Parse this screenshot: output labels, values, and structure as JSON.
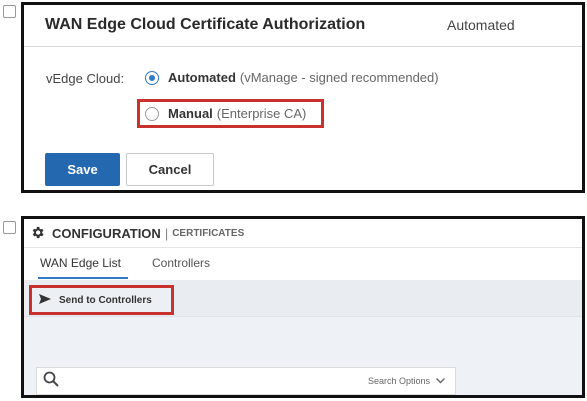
{
  "panel1": {
    "title": "WAN Edge Cloud Certificate Authorization",
    "status": "Automated",
    "field_label": "vEdge Cloud:",
    "option_automated": {
      "label": "Automated",
      "note": "(vManage - signed recommended)",
      "selected": true
    },
    "option_manual": {
      "label": "Manual",
      "note": "(Enterprise CA)",
      "selected": false
    },
    "save_label": "Save",
    "cancel_label": "Cancel"
  },
  "panel2": {
    "title": "CONFIGURATION",
    "separator": "|",
    "subtitle": "CERTIFICATES",
    "tabs": [
      {
        "label": "WAN Edge List",
        "active": true
      },
      {
        "label": "Controllers",
        "active": false
      }
    ],
    "send_label": "Send to Controllers",
    "search": {
      "value": "",
      "options_label": "Search Options"
    }
  },
  "colors": {
    "accent": "#2f7bc4",
    "primary_button": "#2468b0",
    "highlight": "#c8312e"
  },
  "icons": [
    "gear-icon",
    "send-icon",
    "search-icon",
    "chevron-down-icon"
  ]
}
